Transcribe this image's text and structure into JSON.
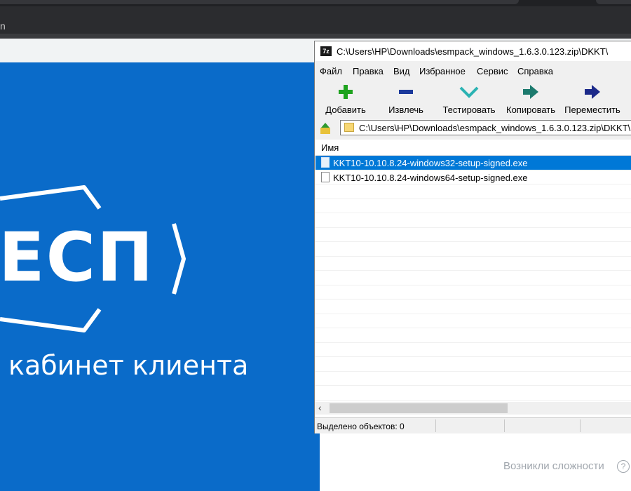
{
  "browser": {
    "address_fragment": "n"
  },
  "hero": {
    "logo_text": "ЕСП",
    "subtitle": "кабинет клиента",
    "bg_color": "#0a6bc9"
  },
  "help": {
    "label": "Возникли сложности",
    "icon": "question-circle-icon"
  },
  "archive_window": {
    "app_icon_text": "7z",
    "title": "C:\\Users\\HP\\Downloads\\esmpack_windows_1.6.3.0.123.zip\\DKKT\\",
    "menu": [
      "Файл",
      "Правка",
      "Вид",
      "Избранное",
      "Сервис",
      "Справка"
    ],
    "toolbar": [
      {
        "label": "Добавить",
        "icon": "plus-icon",
        "color": "#1fa31f"
      },
      {
        "label": "Извлечь",
        "icon": "minus-icon",
        "color": "#1c3a9c"
      },
      {
        "label": "Тестировать",
        "icon": "check-icon",
        "color": "#2bb3b3"
      },
      {
        "label": "Копировать",
        "icon": "copy-arrow-icon",
        "color": "#1c7a6e"
      },
      {
        "label": "Переместить",
        "icon": "move-arrow-icon",
        "color": "#1c2a8a"
      }
    ],
    "path": "C:\\Users\\HP\\Downloads\\esmpack_windows_1.6.3.0.123.zip\\DKKT\\",
    "column_name": "Имя",
    "files": [
      {
        "name": "KKT10-10.10.8.24-windows32-setup-signed.exe",
        "selected": true
      },
      {
        "name": "KKT10-10.10.8.24-windows64-setup-signed.exe",
        "selected": false
      }
    ],
    "status": "Выделено объектов: 0",
    "selection_color": "#0078d7"
  }
}
